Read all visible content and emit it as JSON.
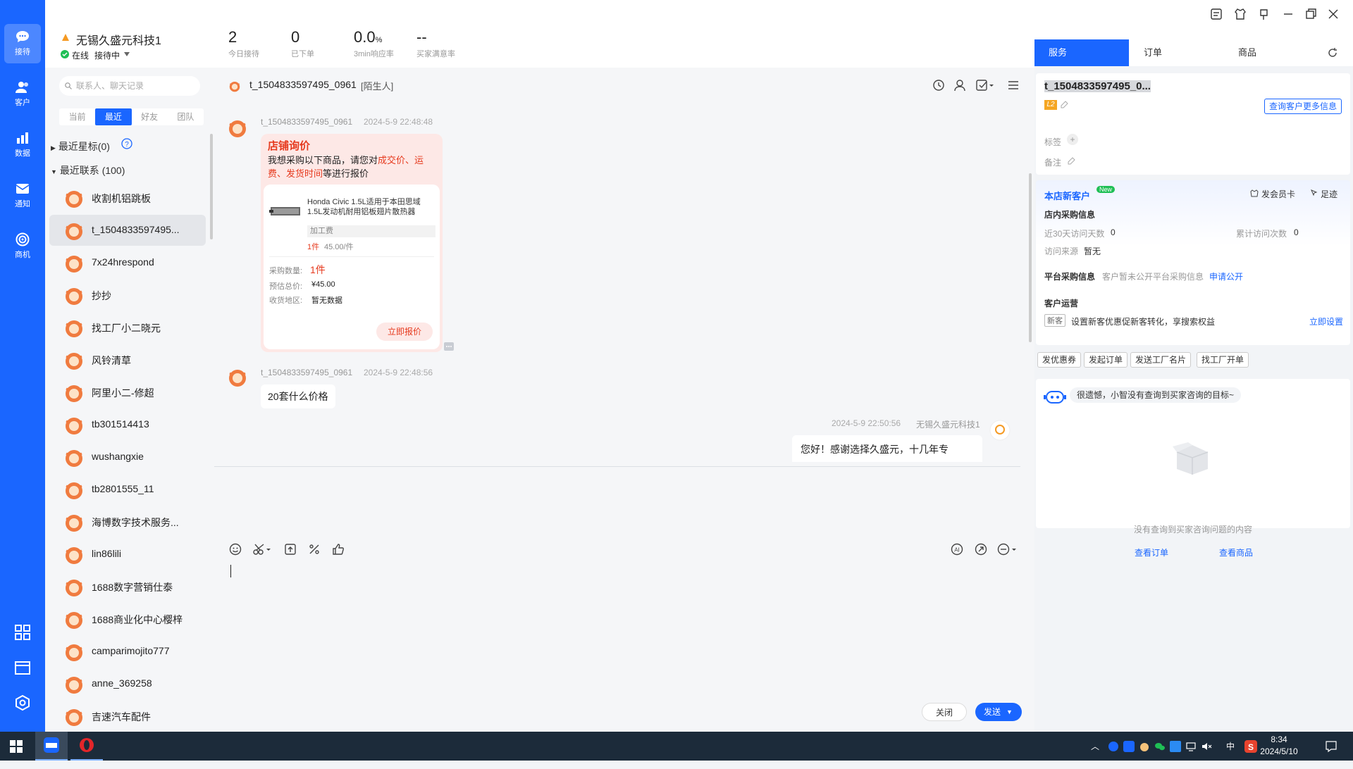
{
  "nav": {
    "items": [
      {
        "label": "接待"
      },
      {
        "label": "客户"
      },
      {
        "label": "数据"
      },
      {
        "label": "通知"
      },
      {
        "label": "商机"
      }
    ]
  },
  "header": {
    "shop_name": "无锡久盛元科技1",
    "status": "在线",
    "mode": "接待中",
    "stats": [
      {
        "value": "2",
        "label": "今日接待"
      },
      {
        "value": "0",
        "label": "已下单"
      },
      {
        "value": "0.0",
        "unit": "%",
        "label": "3min响应率"
      },
      {
        "value": "--",
        "label": "买家满意率"
      }
    ]
  },
  "contacts": {
    "search_placeholder": "联系人、聊天记录",
    "tabs": [
      "当前",
      "最近",
      "好友",
      "团队"
    ],
    "starred": "最近星标(0)",
    "recent": "最近联系 (100)",
    "list": [
      "收割机铝跳板",
      "t_1504833597495...",
      "7x24hrespond",
      "抄抄",
      "找工厂小二晓元",
      "风铃清草",
      "阿里小二-修超",
      "tb301514413",
      "wushangxie",
      "tb2801555_11",
      "海博数字技术服务...",
      "lin86lili",
      "1688数字营销仕泰",
      "1688商业化中心樱梓",
      "camparimojito777",
      "anne_369258",
      "吉速汽车配件"
    ]
  },
  "chat": {
    "title": "t_1504833597495_0961",
    "title_tag": "[陌生人]",
    "m1": {
      "sender": "t_1504833597495_0961",
      "time": "2024-5-9 22:48:48",
      "card_title": "店铺询价",
      "intro_a": "我想采购以下商品，请您对",
      "intro_hl1": "成交价、",
      "intro_hl2": "运费、发货时间",
      "intro_b": "等进行报价",
      "product": "Honda Civic 1.5L适用于本田思域1.5L发动机耐用铝板翅片散热器",
      "spec": "加工费",
      "qty_price_a": "1件",
      "qty_price_b": "45.00/件",
      "qty_label": "采购数量:",
      "qty": "1件",
      "total_label": "预估总价:",
      "total": "¥45.00",
      "area_label": "收货地区:",
      "area": "暂无数据",
      "quote_btn": "立即报价"
    },
    "m2": {
      "sender": "t_1504833597495_0961",
      "time": "2024-5-9 22:48:56",
      "text": "20套什么价格"
    },
    "m3": {
      "time": "2024-5-9 22:50:56",
      "sender": "无锡久盛元科技1",
      "text": "您好！感谢选择久盛元，十几年专"
    },
    "close_btn": "关闭",
    "send_btn": "发送"
  },
  "right": {
    "tabs": [
      "服务",
      "订单",
      "商品"
    ],
    "cust_name": "t_1504833597495_0...",
    "level": "L2",
    "more_btn": "查询客户更多信息",
    "tag_label": "标签",
    "note_label": "备注",
    "new_cust": "本店新客户",
    "new_badge": "New",
    "member_card": "发会员卡",
    "footprint": "足迹",
    "shop_info": "店内采购信息",
    "visit30_label": "近30天访问天数",
    "visit30": "0",
    "total_visit_label": "累计访问次数",
    "total_visit": "0",
    "source_label": "访问来源",
    "source": "暂无",
    "platform_label": "平台采购信息",
    "platform_text": "客户暂未公开平台采购信息",
    "apply": "申请公开",
    "ops_label": "客户运营",
    "new_tag": "新客",
    "ops_text": "设置新客优惠促新客转化，享搜索权益",
    "set_now": "立即设置",
    "actions": [
      "发优惠券",
      "发起订单",
      "发送工厂名片",
      "找工厂开单"
    ],
    "bot_text": "很遗憾，小智没有查询到买家咨询的目标~",
    "empty_text": "没有查询到买家咨询问题的内容",
    "view_order": "查看订单",
    "view_goods": "查看商品"
  },
  "taskbar": {
    "time": "8:34",
    "date": "2024/5/10",
    "ime": "中"
  }
}
